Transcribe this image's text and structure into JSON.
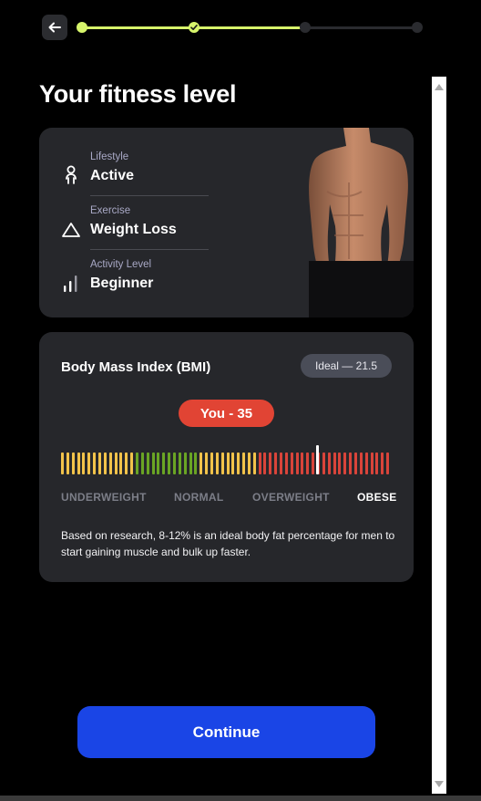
{
  "header": {
    "back_icon": "arrow-left-icon",
    "progress_steps": [
      {
        "state": "done"
      },
      {
        "state": "done"
      },
      {
        "state": "current"
      },
      {
        "state": "upcoming"
      }
    ],
    "completed_steps": 2,
    "total_steps": 4,
    "accent_color": "#d7f56b"
  },
  "page": {
    "title": "Your fitness level"
  },
  "profile": {
    "items": [
      {
        "label": "Lifestyle",
        "value": "Active",
        "icon": "person-icon"
      },
      {
        "label": "Exercise",
        "value": "Weight Loss",
        "icon": "triangle-icon"
      },
      {
        "label": "Activity Level",
        "value": "Beginner",
        "icon": "signal-bars-icon"
      }
    ],
    "image": "male-torso-photo"
  },
  "bmi": {
    "title": "Body Mass Index (BMI)",
    "ideal_label": "Ideal — 21.5",
    "you_label": "You - 35",
    "value": 35,
    "ranges": [
      {
        "label": "UNDERWEIGHT",
        "color": "#f2c34a",
        "active": false
      },
      {
        "label": "NORMAL",
        "color": "#6aa524",
        "active": false
      },
      {
        "label": "OVERWEIGHT",
        "color": "#f2c34a",
        "active": false
      },
      {
        "label": "OBESE",
        "color": "#d9443a",
        "active": true
      }
    ],
    "note": "Based on research, 8-12% is an ideal body fat percentage for men to start gaining muscle and bulk up faster."
  },
  "footer": {
    "continue_label": "Continue",
    "button_color": "#1a45e6"
  }
}
